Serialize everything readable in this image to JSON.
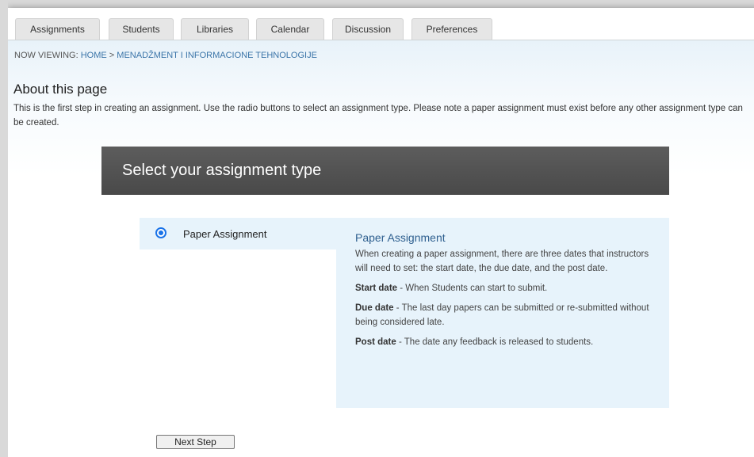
{
  "tabs": [
    {
      "label": "Assignments"
    },
    {
      "label": "Students"
    },
    {
      "label": "Libraries"
    },
    {
      "label": "Calendar"
    },
    {
      "label": "Discussion"
    },
    {
      "label": "Preferences"
    }
  ],
  "breadcrumb": {
    "prefix": "NOW VIEWING:",
    "home": "HOME",
    "separator": ">",
    "current": "MENADŽMENT I INFORMACIONE TEHNOLOGIJE"
  },
  "about": {
    "title": "About this page",
    "text": "This is the first step in creating an assignment. Use the radio buttons to select an assignment type. Please note a paper assignment must exist before any other assignment type can be created."
  },
  "select_header": "Select your assignment type",
  "option": {
    "label": "Paper Assignment",
    "selected": true
  },
  "description": {
    "title": "Paper Assignment",
    "intro": "When creating a paper assignment, there are three dates that instructors will need to set: the start date, the due date, and the post date.",
    "start_label": "Start date",
    "start_text": " - When Students can start to submit.",
    "due_label": "Due date",
    "due_text": " - The last day papers can be submitted or re-submitted without being considered late.",
    "post_label": "Post date",
    "post_text": " - The date any feedback is released to students."
  },
  "next_button": "Next Step",
  "colors": {
    "panel_bg": "#e7f3fb",
    "header_bg": "#555555",
    "link": "#3a74a8",
    "radio": "#1a73e8"
  }
}
